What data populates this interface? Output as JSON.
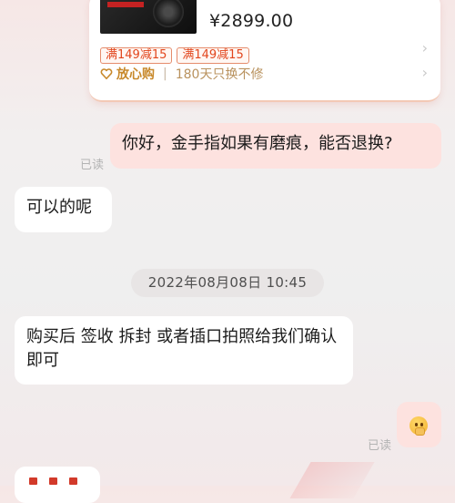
{
  "product_card": {
    "price": "¥2899.00",
    "coupons": [
      "满149减15",
      "满149减15"
    ],
    "assurance": {
      "title": "放心购",
      "separator": "|",
      "detail": "180天只换不修"
    }
  },
  "messages": [
    {
      "id": "m1",
      "direction": "out",
      "text": "你好，金手指如果有磨痕，能否退换?",
      "status": "已读"
    },
    {
      "id": "m2",
      "direction": "in",
      "text": "可以的呢"
    },
    {
      "id": "m3",
      "direction": "in",
      "text": "购买后  签收 拆封 或者插口拍照给我们确认即可"
    },
    {
      "id": "m4",
      "direction": "out",
      "emoji": "thinking-face-icon",
      "status": "已读"
    }
  ],
  "timestamp": "2022年08月08日 10:45",
  "colors": {
    "outgoing_bubble": "#fde2df",
    "incoming_bubble": "#ffffff",
    "coupon_red": "#e2461d",
    "assurance_gold": "#c8892b"
  }
}
